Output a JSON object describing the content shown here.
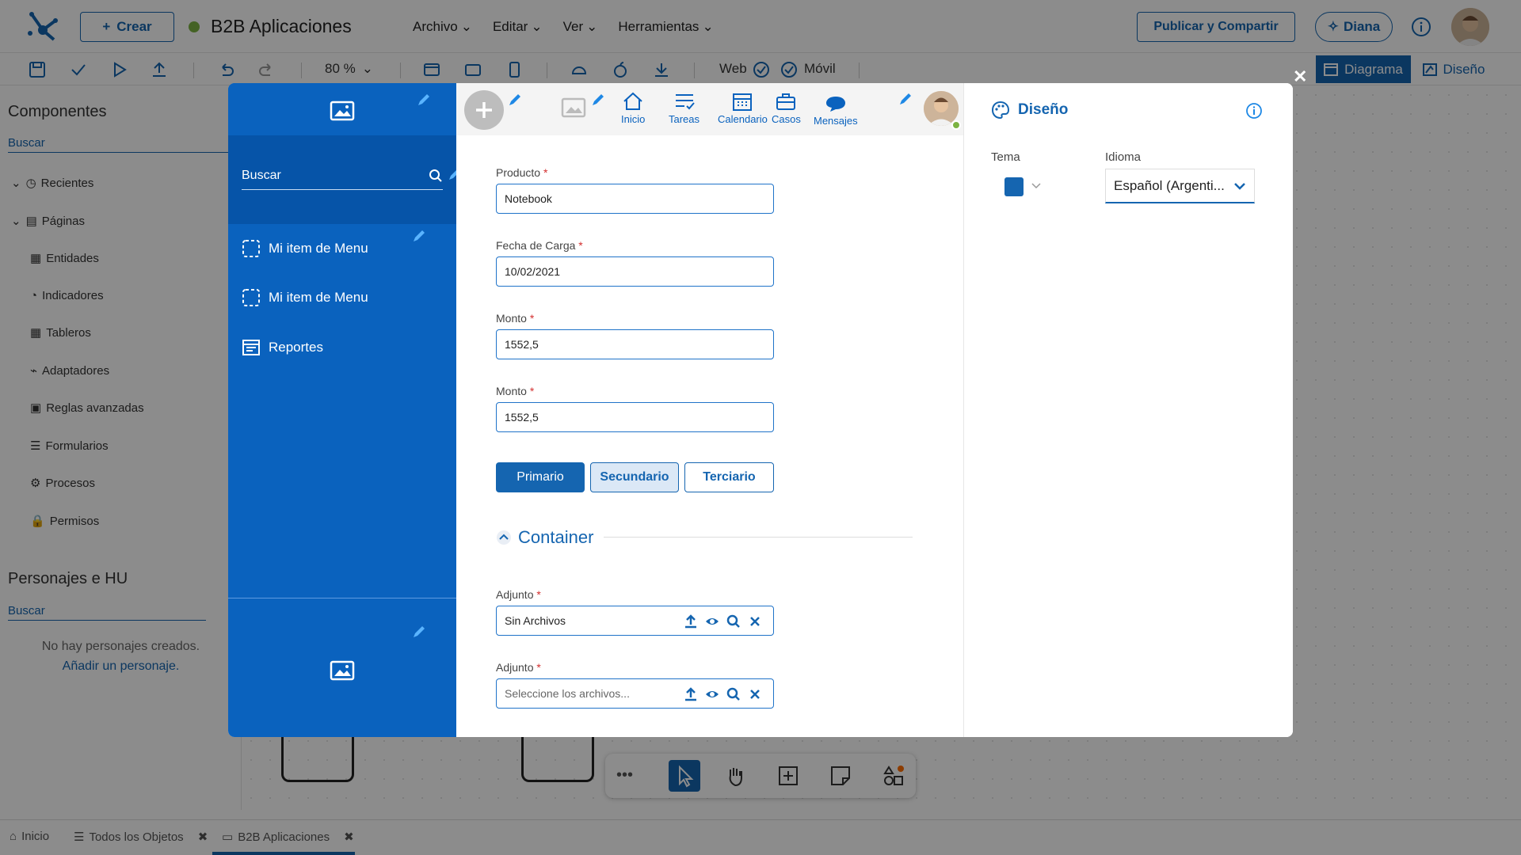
{
  "app": {
    "create_label": "Crear",
    "app_name": "B2B Aplicaciones",
    "menus": [
      "Archivo",
      "Editar",
      "Ver",
      "Herramientas"
    ],
    "publish_label": "Publicar y Compartir",
    "diana_label": "Diana"
  },
  "toolbar": {
    "zoom": "80 %",
    "web_label": "Web",
    "movil_label": "Móvil",
    "tab_diagram": "Diagrama",
    "tab_design": "Diseño"
  },
  "left_panel": {
    "title": "Componentes",
    "search_placeholder": "Buscar",
    "tree": [
      "Recientes",
      "Páginas",
      "Entidades",
      "Indicadores",
      "Tableros",
      "Adaptadores",
      "Reglas avanzadas",
      "Formularios",
      "Procesos",
      "Permisos"
    ],
    "personas_title": "Personajes e HU",
    "personas_search": "Buscar",
    "personas_empty": "No hay personajes creados.",
    "personas_add": "Añadir un personaje."
  },
  "bottom_tabs": [
    "Inicio",
    "Todos los Objetos",
    "B2B Aplicaciones"
  ],
  "modal": {
    "side": {
      "search_placeholder": "Buscar",
      "menu_items": [
        "Mi item de Menu",
        "Mi item de Menu",
        "Reportes"
      ]
    },
    "header_nav": [
      "Inicio",
      "Tareas",
      "Calendario",
      "Casos",
      "Mensajes"
    ],
    "form": {
      "fields": [
        {
          "label": "Producto",
          "value": "Notebook"
        },
        {
          "label": "Fecha de Carga",
          "value": "10/02/2021"
        },
        {
          "label": "Monto",
          "value": "1552,5"
        },
        {
          "label": "Monto",
          "value": "1552,5"
        }
      ],
      "buttons": {
        "primary": "Primario",
        "secondary": "Secundario",
        "tertiary": "Terciario"
      },
      "container_title": "Container",
      "attachments": [
        {
          "label": "Adjunto",
          "value": "Sin Archivos"
        },
        {
          "label": "Adjunto",
          "placeholder": "Seleccione los archivos..."
        }
      ]
    },
    "design": {
      "title": "Diseño",
      "tema_label": "Tema",
      "tema_color": "#1565b0",
      "idioma_label": "Idioma",
      "idioma_value": "Español (Argenti..."
    }
  },
  "colors": {
    "accent": "#1565b0",
    "sidebar": "#0a62be"
  }
}
